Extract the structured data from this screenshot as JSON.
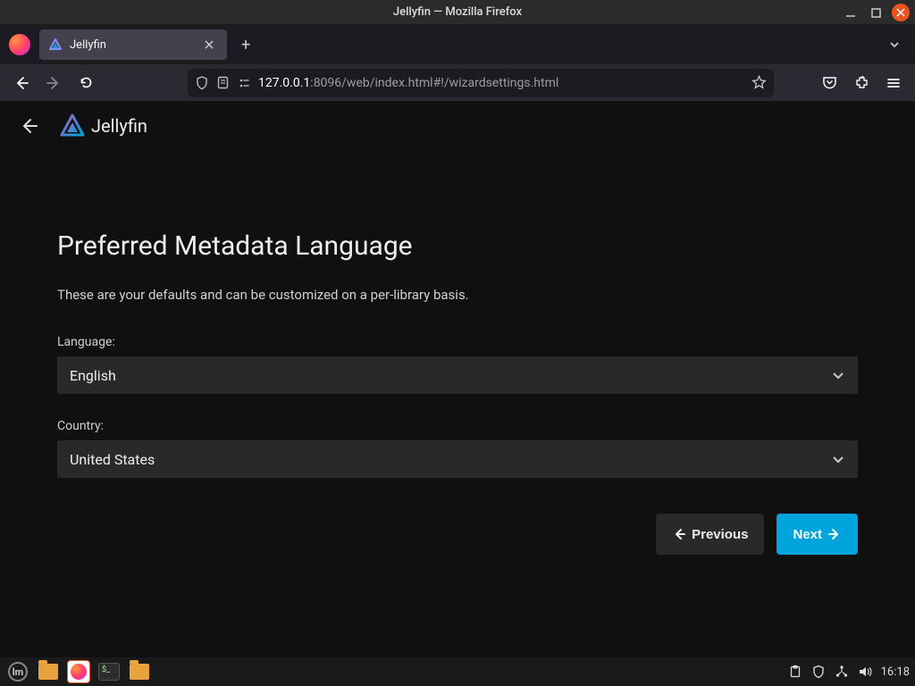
{
  "window": {
    "title": "Jellyfin — Mozilla Firefox"
  },
  "browser": {
    "tab": {
      "title": "Jellyfin"
    },
    "url": {
      "host": "127.0.0.1",
      "path": ":8096/web/index.html#!/wizardsettings.html"
    }
  },
  "jellyfin": {
    "brand": "Jellyfin",
    "wizard": {
      "title": "Preferred Metadata Language",
      "subtitle": "These are your defaults and can be customized on a per-library basis.",
      "language_label": "Language:",
      "language_value": "English",
      "country_label": "Country:",
      "country_value": "United States",
      "prev_label": "Previous",
      "next_label": "Next"
    }
  },
  "taskbar": {
    "clock": "16:18"
  }
}
